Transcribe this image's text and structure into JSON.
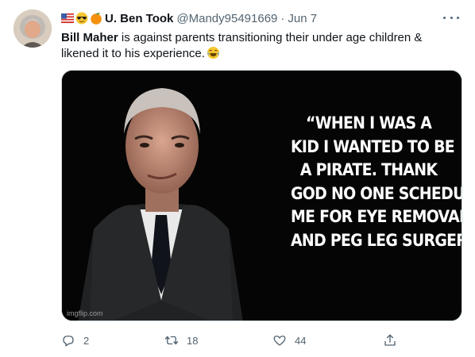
{
  "tweet": {
    "user": {
      "display_name": "U. Ben Took",
      "handle": "@Mandy95491669",
      "separator": "·",
      "date": "Jun 7",
      "emojis": [
        "us-flag-icon",
        "sunglasses-face-icon",
        "orange-icon"
      ]
    },
    "text": {
      "bold": "Bill Maher",
      "rest": " is against parents transitioning their under age children & likened it to his experience.",
      "emoji": "tears-of-joy-icon"
    },
    "media": {
      "quote_lines": [
        "“WHEN I WAS A",
        "KID I WANTED TO BE",
        "A PIRATE. THANK",
        "GOD NO ONE SCHEDULED",
        "ME FOR EYE REMOVAL",
        "AND PEG LEG SURGERY.\""
      ],
      "watermark": "imgflip.com"
    },
    "actions": {
      "replies": "2",
      "retweets": "18",
      "likes": "44"
    },
    "colors": {
      "secondary_text": "#536471",
      "primary_text": "#0f1419",
      "media_background": "#050505"
    }
  }
}
